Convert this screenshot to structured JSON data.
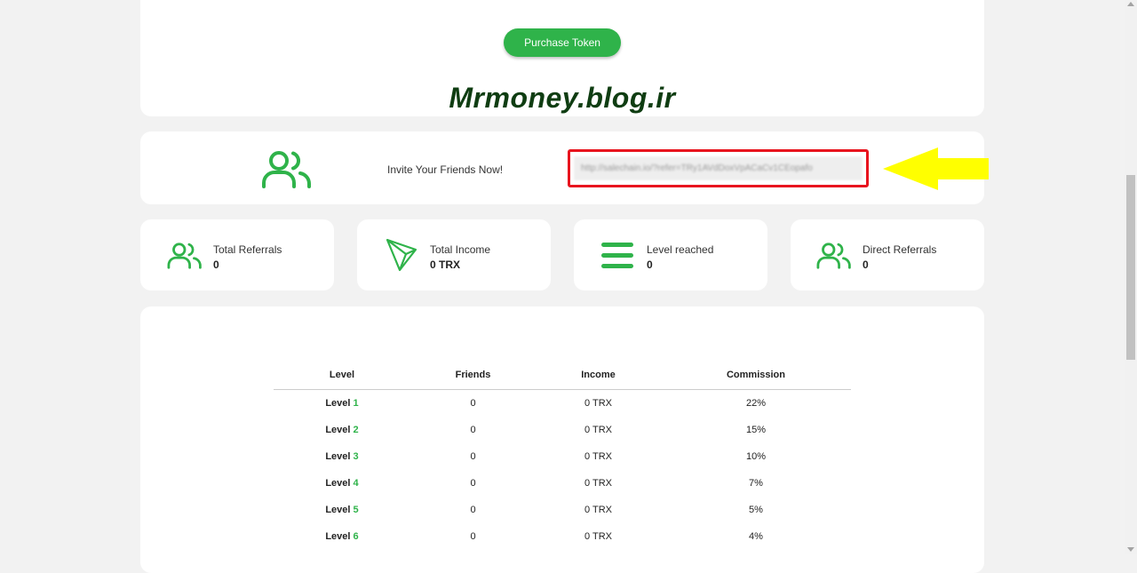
{
  "header": {
    "purchase_button": "Purchase Token",
    "watermark": "Mrmoney.blog.ir"
  },
  "invite": {
    "label": "Invite Your Friends Now!",
    "referral_link": "http://salechain.io/?refer=TRy1AVdDoxVpACaCv1CEopafo",
    "icon": "users-icon",
    "highlight_color": "#e8141e",
    "arrow_color": "#ffff00"
  },
  "stats": [
    {
      "label": "Total Referrals",
      "value": "0",
      "icon": "users-icon"
    },
    {
      "label": "Total Income",
      "value": "0 TRX",
      "icon": "tron-icon"
    },
    {
      "label": "Level reached",
      "value": "0",
      "icon": "menu-bars-icon"
    },
    {
      "label": "Direct Referrals",
      "value": "0",
      "icon": "users-icon"
    }
  ],
  "levels_table": {
    "headers": [
      "Level",
      "Friends",
      "Income",
      "Commission"
    ],
    "level_word": "Level",
    "rows": [
      {
        "level": "1",
        "friends": "0",
        "income": "0 TRX",
        "commission": "22%"
      },
      {
        "level": "2",
        "friends": "0",
        "income": "0 TRX",
        "commission": "15%"
      },
      {
        "level": "3",
        "friends": "0",
        "income": "0 TRX",
        "commission": "10%"
      },
      {
        "level": "4",
        "friends": "0",
        "income": "0 TRX",
        "commission": "7%"
      },
      {
        "level": "5",
        "friends": "0",
        "income": "0 TRX",
        "commission": "5%"
      },
      {
        "level": "6",
        "friends": "0",
        "income": "0 TRX",
        "commission": "4%"
      }
    ]
  },
  "colors": {
    "accent": "#2fb34a",
    "background": "#f2f2f2",
    "card": "#ffffff"
  }
}
